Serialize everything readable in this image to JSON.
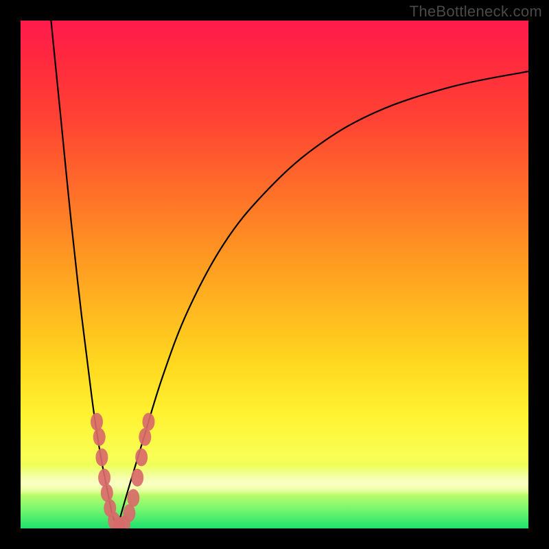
{
  "watermark": "TheBottleneck.com",
  "chart_data": {
    "type": "line",
    "title": "",
    "xlabel": "",
    "ylabel": "",
    "xlim": [
      0,
      100
    ],
    "ylim": [
      0,
      100
    ],
    "notes": "Bottleneck-style V-curve. X is a normalized component-balance axis; Y is bottleneck percentage (0 = none, 100 = severe). Background gradient green→red encodes same 0–100 scale. Minimum (optimal point) is near x≈19.",
    "series": [
      {
        "name": "left-branch",
        "x": [
          6,
          8,
          10,
          12,
          14,
          15,
          16,
          17,
          18,
          19
        ],
        "values": [
          100,
          80,
          60,
          42,
          26,
          19,
          13,
          8,
          3,
          0
        ]
      },
      {
        "name": "right-branch",
        "x": [
          19,
          21,
          24,
          28,
          33,
          40,
          48,
          58,
          70,
          85,
          100
        ],
        "values": [
          0,
          7,
          17,
          30,
          43,
          56,
          66,
          75,
          82,
          87,
          90
        ]
      }
    ],
    "markers": {
      "name": "sample-points",
      "color": "#d86a6a",
      "points": [
        {
          "x": 15.0,
          "y": 21
        },
        {
          "x": 15.5,
          "y": 18
        },
        {
          "x": 16.0,
          "y": 14
        },
        {
          "x": 16.5,
          "y": 10
        },
        {
          "x": 17.0,
          "y": 7
        },
        {
          "x": 17.6,
          "y": 4
        },
        {
          "x": 18.4,
          "y": 1.5
        },
        {
          "x": 19.4,
          "y": 0.5
        },
        {
          "x": 20.4,
          "y": 0.8
        },
        {
          "x": 21.4,
          "y": 3
        },
        {
          "x": 22.2,
          "y": 6
        },
        {
          "x": 23.0,
          "y": 10
        },
        {
          "x": 23.8,
          "y": 14
        },
        {
          "x": 24.5,
          "y": 18
        },
        {
          "x": 25.2,
          "y": 21
        }
      ]
    }
  }
}
